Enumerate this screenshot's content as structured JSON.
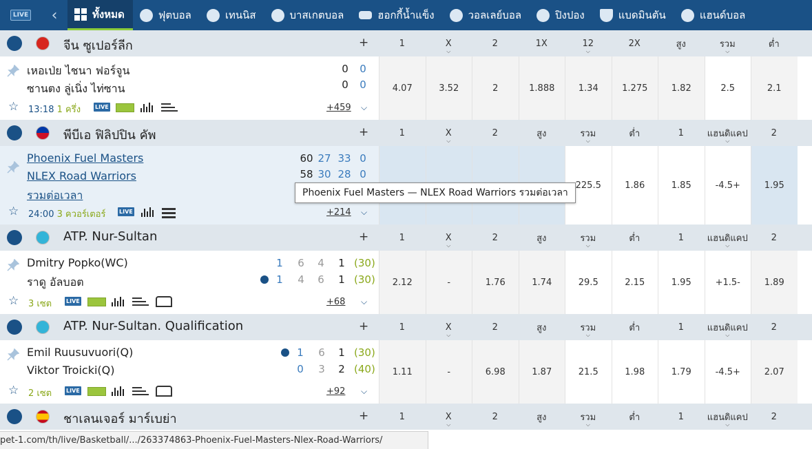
{
  "app": {
    "logo_text": "LIVE"
  },
  "tabs": [
    {
      "label": "ทั้งหมด",
      "icon": "grid-icon"
    },
    {
      "label": "ฟุตบอล",
      "icon": "soccer-ball-icon"
    },
    {
      "label": "เทนนิส",
      "icon": "tennis-ball-icon"
    },
    {
      "label": "บาสเกตบอล",
      "icon": "basketball-icon"
    },
    {
      "label": "ฮอกกี้น้ำแข็ง",
      "icon": "hockey-puck-icon"
    },
    {
      "label": "วอลเลย์บอล",
      "icon": "volleyball-icon"
    },
    {
      "label": "ปิงปอง",
      "icon": "ping-pong-icon"
    },
    {
      "label": "แบดมินตัน",
      "icon": "shuttlecock-icon"
    },
    {
      "label": "แฮนด์บอล",
      "icon": "handball-icon"
    }
  ],
  "leagues": [
    {
      "name": "จีน ซูเปอร์ลีก",
      "plus": "+",
      "cols": [
        "1",
        "X",
        "2",
        "1X",
        "12",
        "2X",
        "สูง",
        "รวม",
        "ต่ำ"
      ],
      "match": {
        "team1": "เหอเป่ย ไชนา ฟอร์จูน",
        "team2": "ซานตง ลู่เนิ่ง ไท่ซาน",
        "s1": [
          "0",
          "0"
        ],
        "s2": [
          "0",
          "0"
        ],
        "time": "13:18",
        "period": "1 ครึ่ง",
        "more": "+459",
        "odds": [
          "4.07",
          "3.52",
          "2",
          "1.888",
          "1.34",
          "1.275",
          "1.82",
          "2.5",
          "2.1"
        ]
      }
    },
    {
      "name": "พีบีเอ ฟิลิปปิน คัพ",
      "plus": "+",
      "cols": [
        "1",
        "X",
        "2",
        "สูง",
        "รวม",
        "ต่ำ",
        "1",
        "แฮนดิแคป",
        "2"
      ],
      "match": {
        "team1": "Phoenix Fuel Masters",
        "team2": "NLEX Road Warriors",
        "extra": "รวมต่อเวลา",
        "s1": [
          "60",
          "27",
          "33",
          "0"
        ],
        "s2": [
          "58",
          "30",
          "28",
          "0"
        ],
        "time": "24:00",
        "period": "3 ควอร์เตอร์",
        "more": "+214",
        "odds": [
          "",
          "",
          "",
          "",
          "225.5",
          "1.86",
          "1.85",
          "-4.5+",
          "1.95"
        ],
        "tooltip": "Phoenix Fuel Masters — NLEX Road Warriors รวมต่อเวลา"
      }
    },
    {
      "name": "ATP. Nur-Sultan",
      "plus": "+",
      "cols": [
        "1",
        "X",
        "2",
        "สูง",
        "รวม",
        "ต่ำ",
        "1",
        "แฮนดิแคป",
        "2"
      ],
      "match": {
        "team1": "Dmitry Popko(WC)",
        "team2": "ราดู อัลบอต",
        "s1": [
          "1",
          "6",
          "4",
          "1",
          "(30)"
        ],
        "s2": [
          "1",
          "4",
          "6",
          "1",
          "(30)"
        ],
        "time": "",
        "period": "3 เซต",
        "more": "+68",
        "odds": [
          "2.12",
          "-",
          "1.76",
          "1.74",
          "29.5",
          "2.15",
          "1.95",
          "+1.5-",
          "1.89"
        ]
      }
    },
    {
      "name": "ATP. Nur-Sultan. Qualification",
      "plus": "+",
      "cols": [
        "1",
        "X",
        "2",
        "สูง",
        "รวม",
        "ต่ำ",
        "1",
        "แฮนดิแคป",
        "2"
      ],
      "match": {
        "team1": "Emil Ruusuvuori(Q)",
        "team2": "Viktor Troicki(Q)",
        "s1": [
          "1",
          "6",
          "1",
          "(30)"
        ],
        "s2": [
          "0",
          "3",
          "2",
          "(40)"
        ],
        "time": "",
        "period": "2 เซต",
        "more": "+92",
        "odds": [
          "1.11",
          "-",
          "6.98",
          "1.87",
          "21.5",
          "1.98",
          "1.79",
          "-4.5+",
          "2.07"
        ]
      }
    },
    {
      "name": "ชาเลนเจอร์ มาร์เบย่า",
      "plus": "+",
      "cols": [
        "1",
        "X",
        "2",
        "สูง",
        "รวม",
        "ต่ำ",
        "1",
        "แฮนดิแคป",
        "2"
      ]
    }
  ],
  "badges": {
    "live": "LIVE"
  },
  "status_url": "pet-1.com/th/live/Basketball/.../263374863-Phoenix-Fuel-Masters-Nlex-Road-Warriors/",
  "colors": {
    "nav": "#1a5186",
    "accent_green": "#8ccc3a",
    "header_bg": "#dfe6ec"
  }
}
